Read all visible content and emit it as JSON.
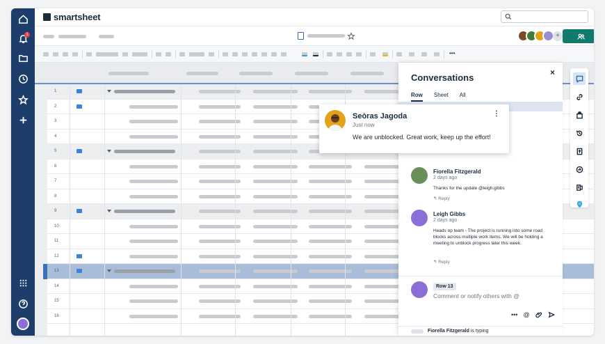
{
  "app": {
    "brand": "smartsheet"
  },
  "nav": {
    "notification_count": "1"
  },
  "search": {
    "placeholder": ""
  },
  "grid": {
    "rows": [
      {
        "num": "1",
        "comment": true,
        "parent": true
      },
      {
        "num": "2",
        "comment": true
      },
      {
        "num": "3"
      },
      {
        "num": "4"
      },
      {
        "num": "5",
        "comment": true,
        "parent": true
      },
      {
        "num": "6"
      },
      {
        "num": "7"
      },
      {
        "num": "8"
      },
      {
        "num": "9",
        "comment": true,
        "parent": true
      },
      {
        "num": "10"
      },
      {
        "num": "11"
      },
      {
        "num": "12",
        "comment": true
      },
      {
        "num": "13",
        "comment": true,
        "parent": true,
        "selected": true
      },
      {
        "num": "14"
      },
      {
        "num": "15"
      },
      {
        "num": "16"
      }
    ]
  },
  "conversations": {
    "title": "Conversations",
    "tabs": [
      "Row",
      "Sheet",
      "All"
    ],
    "close_label": "×",
    "comments": [
      {
        "name": "Fiorella Fitzgerald",
        "time": "2 days ago",
        "body": "Thanks for the update @leigh.gibbs",
        "reply": "↰ Reply"
      },
      {
        "name": "Leigh Gibbs",
        "time": "2 days ago",
        "body": "Heads up team - The project is running into some road blocks across multiple work items. We will be holding a meeting to unblock progress later this week.",
        "reply": "↰ Reply"
      }
    ],
    "row_tag": "Row 13",
    "input_placeholder": "Comment or notify others with @",
    "more_label": "•••",
    "at_label": "@",
    "typing_name": "Fiorella Fitzgerald",
    "typing_text": " is typing"
  },
  "toast": {
    "name": "Seòras Jagoda",
    "time": "Just now",
    "message": "We are unblocked. Great work, keep up the effort!",
    "menu": "⋮"
  },
  "colors": {
    "nav_bg": "#1d3e6a",
    "share_button": "#107a6d",
    "selected_row": "#a9bcd8",
    "comment_icon": "#3d83d6"
  }
}
